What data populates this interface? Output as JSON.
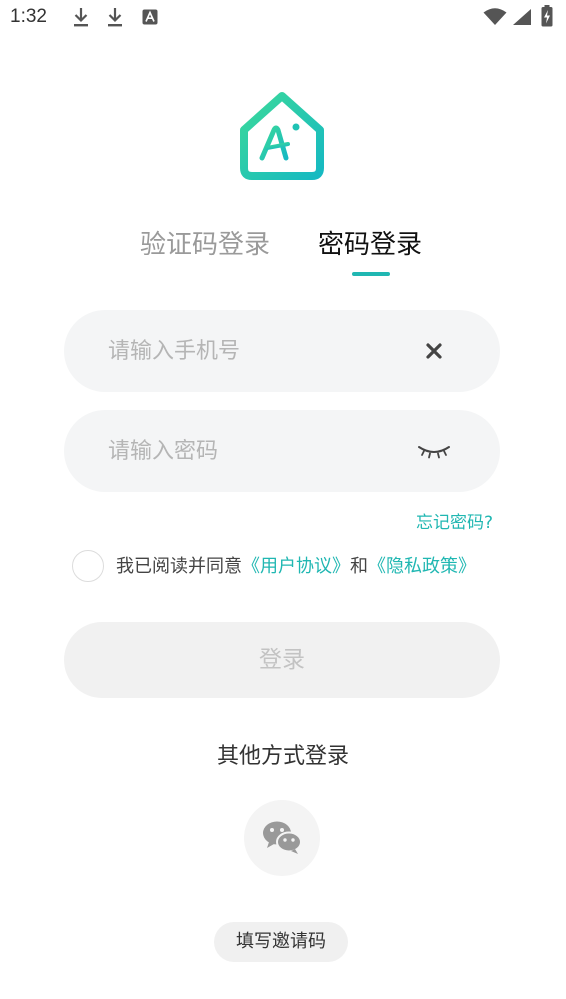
{
  "status_bar": {
    "time": "1:32",
    "icons": [
      "download-icon",
      "download-icon",
      "a-notification-icon",
      "wifi-icon",
      "signal-icon",
      "battery-charging-icon"
    ]
  },
  "logo": {
    "text": "Ai",
    "colors": {
      "primary": "#1fc2b4",
      "secondary": "#3bd99a"
    }
  },
  "tabs": [
    {
      "label": "验证码登录",
      "active": false
    },
    {
      "label": "密码登录",
      "active": true
    }
  ],
  "phone": {
    "placeholder": "请输入手机号",
    "value": ""
  },
  "password": {
    "placeholder": "请输入密码",
    "value": ""
  },
  "forgot_password": "忘记密码?",
  "agreement": {
    "prefix": "我已阅读并同意",
    "user_agreement": "《用户协议》",
    "and": "和",
    "privacy_policy": "《隐私政策》",
    "checked": false
  },
  "login_button": "登录",
  "other_login": {
    "title": "其他方式登录",
    "options": [
      "wechat-icon"
    ]
  },
  "invite_code_button": "填写邀请码",
  "colors": {
    "accent": "#20b7b2",
    "field_bg": "#f4f5f6",
    "button_disabled_bg": "#f1f1f1",
    "placeholder": "#b5b5b5"
  }
}
